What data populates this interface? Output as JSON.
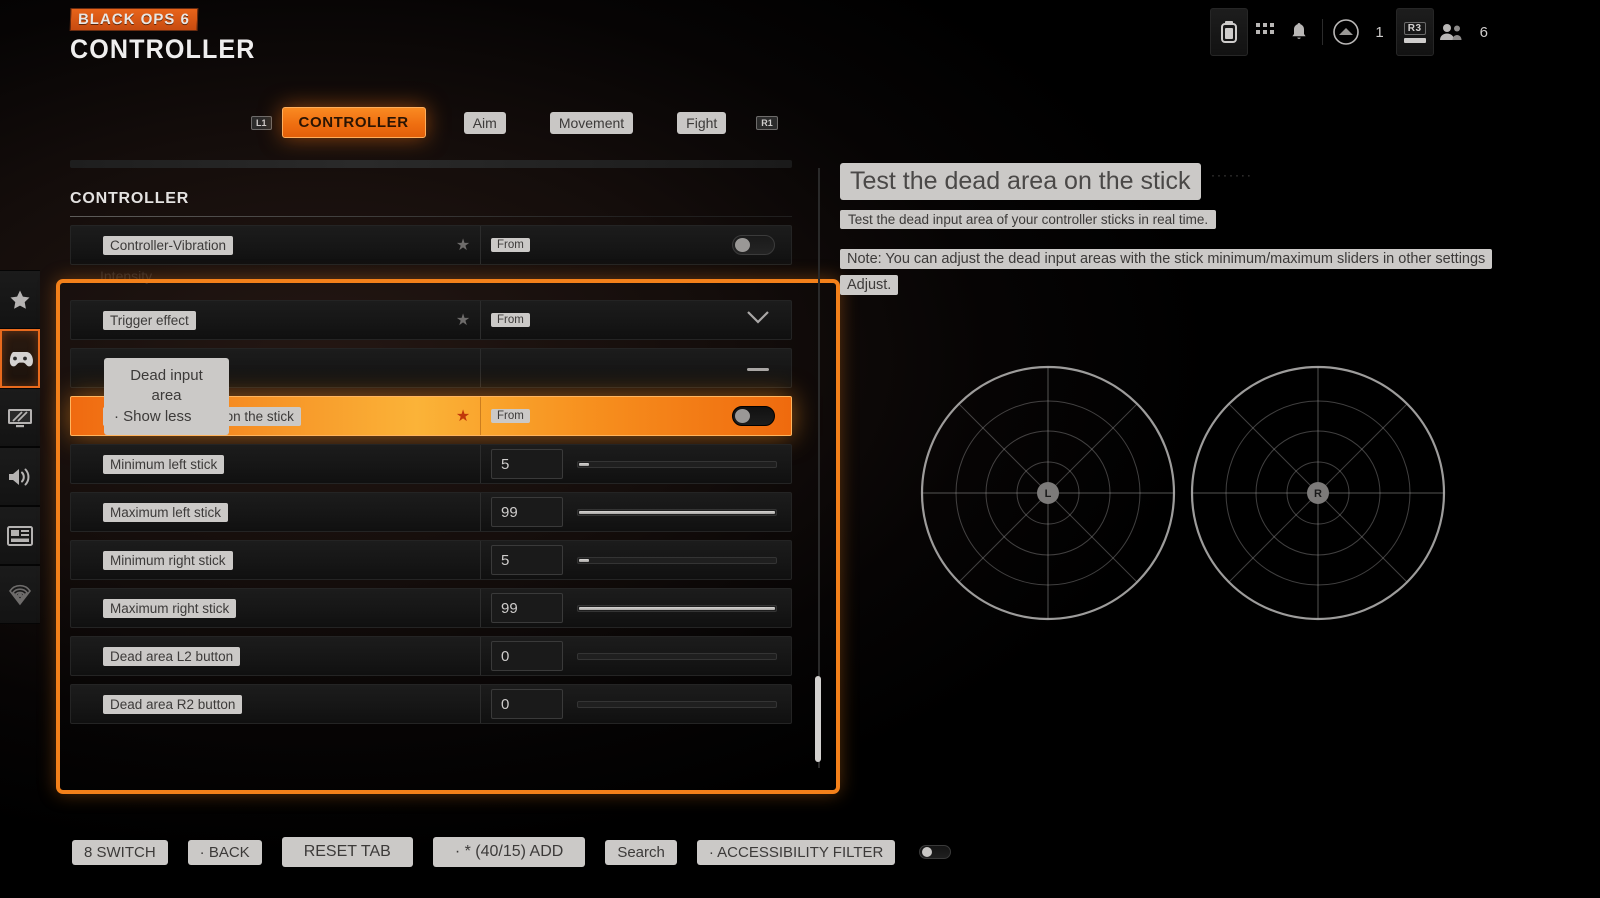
{
  "header": {
    "logo_badge": "BLACK OPS 6",
    "title": "CONTROLLER"
  },
  "hud": {
    "battery_icon": "battery-icon",
    "grid_icon": "grid-icon",
    "bell_icon": "bell-icon",
    "emblem_icon": "emblem-icon",
    "emblem_count": "1",
    "r3_key_label": "R3",
    "friends_icon": "friends-icon",
    "friends_count": "6"
  },
  "sidebar": {
    "items": [
      {
        "name": "favorites",
        "icon": "star-icon",
        "active": false
      },
      {
        "name": "controller",
        "icon": "gamepad-icon",
        "active": true
      },
      {
        "name": "graphics",
        "icon": "monitor-icon",
        "active": false
      },
      {
        "name": "audio",
        "icon": "speaker-icon",
        "active": false
      },
      {
        "name": "account",
        "icon": "id-card-icon",
        "active": false
      },
      {
        "name": "network",
        "icon": "signal-icon",
        "active": false
      }
    ]
  },
  "tabs": {
    "left_bumper": "L1",
    "right_bumper": "R1",
    "items": [
      {
        "label": "CONTROLLER",
        "active": true
      },
      {
        "label": "Aim",
        "active": false
      },
      {
        "label": "Movement",
        "active": false
      },
      {
        "label": "Fight",
        "active": false
      }
    ]
  },
  "panel": {
    "section_title": "CONTROLLER",
    "from_chip": "From",
    "rows": [
      {
        "label": "Controller-Vibration",
        "type": "toggle",
        "star": "★",
        "from": "From",
        "value": "off"
      },
      {
        "label": "Trigger effect",
        "type": "dropdown",
        "star": "★",
        "from": "From",
        "value": ""
      },
      {
        "label": "",
        "type": "collapse",
        "star": "",
        "from": "",
        "value": ""
      },
      {
        "label": "Test the dead area on the stick",
        "type": "toggle",
        "star": "★",
        "from": "From",
        "value": "off",
        "selected": true
      },
      {
        "label": "Minimum left stick",
        "type": "slider",
        "value": "5",
        "percent": 5
      },
      {
        "label": "Maximum left stick",
        "type": "slider",
        "value": "99",
        "percent": 99
      },
      {
        "label": "Minimum right stick",
        "type": "slider",
        "value": "5",
        "percent": 5
      },
      {
        "label": "Maximum right stick",
        "type": "slider",
        "value": "99",
        "percent": 99
      },
      {
        "label": "Dead area L2 button",
        "type": "slider",
        "value": "0",
        "percent": 0
      },
      {
        "label": "Dead area R2 button",
        "type": "slider",
        "value": "0",
        "percent": 0
      }
    ]
  },
  "popover": {
    "line1": "Dead input",
    "line2": "area",
    "line3": "· Show less"
  },
  "description": {
    "title": "Test the dead area on the stick",
    "dots": "·······",
    "subtitle": "Test the dead input area of your controller sticks in real time.",
    "note": "Note: You can adjust the dead input areas with the stick minimum/maximum sliders in other settings",
    "note2": "Adjust."
  },
  "sticks": [
    {
      "label": "L",
      "name": "left-stick-visualizer"
    },
    {
      "label": "R",
      "name": "right-stick-visualizer"
    }
  ],
  "bottom_bar": {
    "buttons": [
      {
        "label": "8 SWITCH",
        "name": "switch-button",
        "wide": false
      },
      {
        "label": "· BACK",
        "name": "back-button",
        "wide": false
      },
      {
        "label": "RESET TAB",
        "name": "reset-tab-button",
        "wide": true
      },
      {
        "label": "· * (40/15) ADD",
        "name": "add-button",
        "wide": true
      },
      {
        "label": "Search",
        "name": "search-button",
        "wide": false
      },
      {
        "label": "· ACCESSIBILITY FILTER",
        "name": "accessibility-filter-button",
        "wide": false
      }
    ],
    "filter_toggle": "off"
  },
  "colors": {
    "accent": "#f3801a",
    "highlight_row_start": "#f06a10",
    "highlight_row_mid": "#fbb338",
    "label_bg": "#cbc9c7",
    "label_fg": "#3c3a39"
  }
}
